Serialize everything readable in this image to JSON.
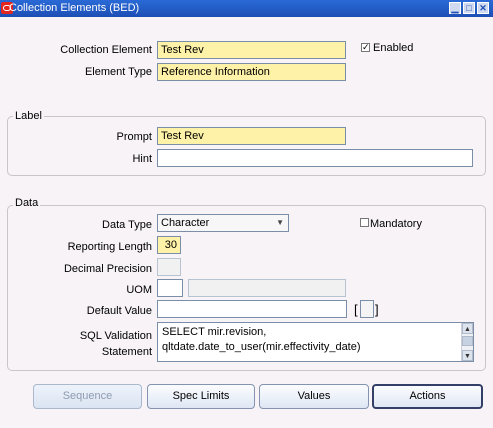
{
  "window": {
    "title": "Collection Elements (BED)"
  },
  "main": {
    "collection_element_label": "Collection Element",
    "collection_element_value": "Test Rev",
    "enabled_label": "Enabled",
    "enabled_checked": true,
    "element_type_label": "Element Type",
    "element_type_value": "Reference Information"
  },
  "label_group": {
    "title": "Label",
    "prompt_label": "Prompt",
    "prompt_value": "Test Rev",
    "hint_label": "Hint",
    "hint_value": ""
  },
  "data_group": {
    "title": "Data",
    "data_type_label": "Data Type",
    "data_type_value": "Character",
    "mandatory_label": "Mandatory",
    "mandatory_checked": false,
    "reporting_length_label": "Reporting Length",
    "reporting_length_value": "30",
    "decimal_precision_label": "Decimal Precision",
    "decimal_precision_value": "",
    "uom_label": "UOM",
    "uom_value": "",
    "uom_desc_value": "",
    "default_value_label": "Default Value",
    "default_value_value": "",
    "bracket_open": "[",
    "bracket_close": "]",
    "sql_validation_label_1": "SQL Validation",
    "sql_validation_label_2": "Statement",
    "sql_lines": [
      "SELECT mir.revision,",
      "        qltdate.date_to_user(mir.effectivity_date)"
    ]
  },
  "buttons": {
    "sequence": "Sequence",
    "spec_limits": "Spec Limits",
    "values": "Values",
    "actions": "Actions"
  },
  "colors": {
    "titlebar": "#1d4fb5",
    "required_field": "#fef2a8",
    "background": "#f7f3f7"
  }
}
